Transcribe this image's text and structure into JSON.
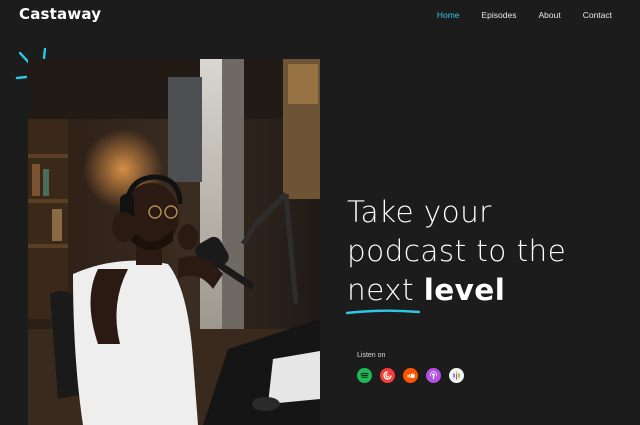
{
  "brand": {
    "name": "Castaway"
  },
  "nav": {
    "items": [
      {
        "label": "Home",
        "active": true
      },
      {
        "label": "Episodes",
        "active": false
      },
      {
        "label": "About",
        "active": false
      },
      {
        "label": "Contact",
        "active": false
      }
    ]
  },
  "hero": {
    "headline_line1": "Take your",
    "headline_line2": "podcast to the",
    "headline_word_underlined": "next",
    "headline_word_bold": "level",
    "listen_label": "Listen on",
    "platforms": [
      {
        "icon": "spotify-icon",
        "color": "#1db954"
      },
      {
        "icon": "pocketcasts-icon",
        "color": "#f43e37"
      },
      {
        "icon": "soundcloud-icon",
        "color": "#ff5500"
      },
      {
        "icon": "apple-podcasts-icon",
        "color": "#b150e2"
      },
      {
        "icon": "google-podcasts-icon",
        "color": "#f4f4f4"
      }
    ]
  },
  "colors": {
    "accent": "#2ec6e6",
    "background": "#1c1c1c"
  }
}
